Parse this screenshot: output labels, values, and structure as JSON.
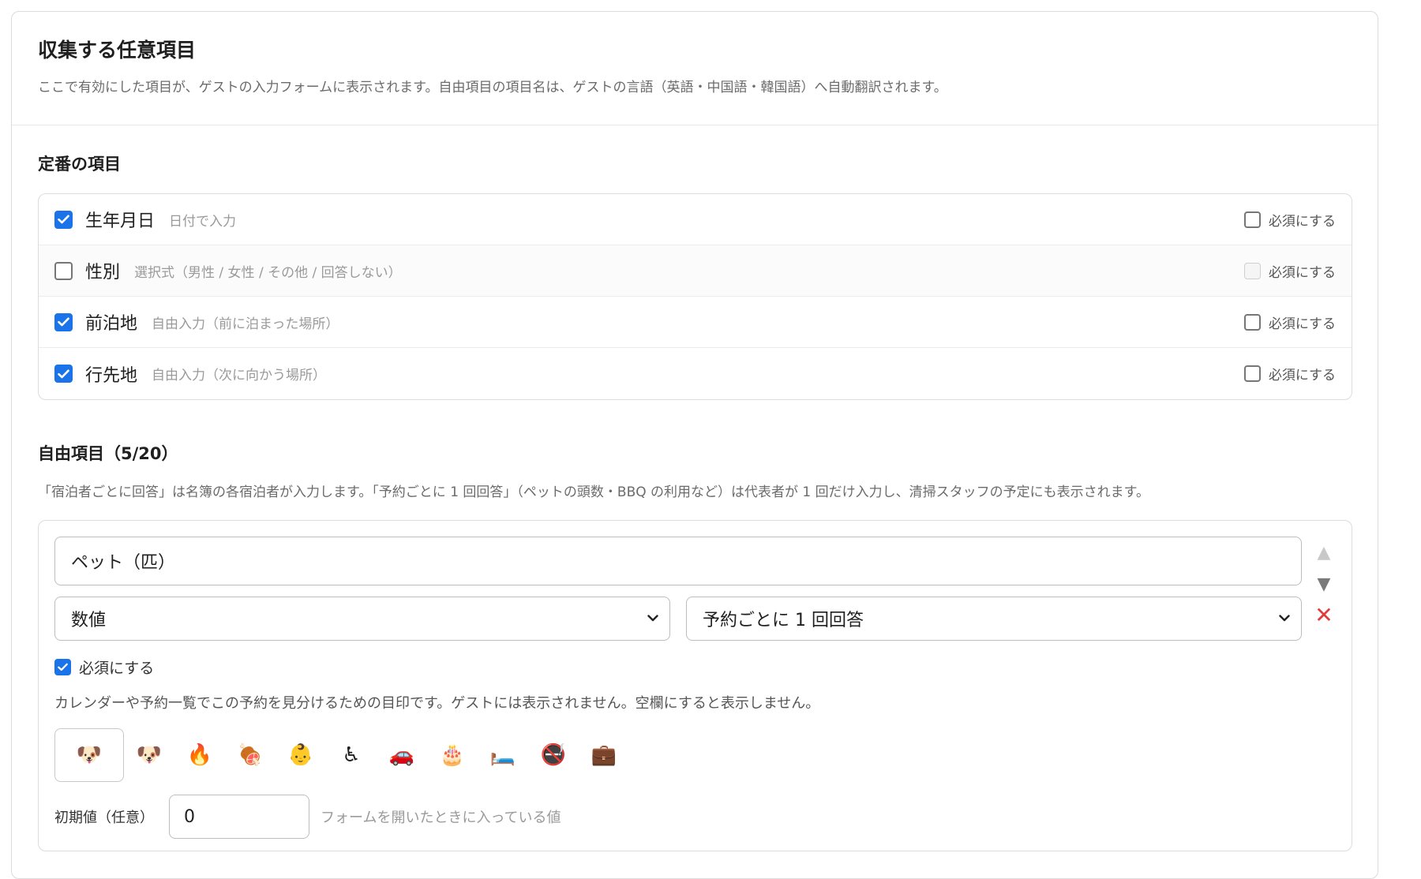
{
  "header": {
    "title": "収集する任意項目",
    "description": "ここで有効にした項目が、ゲストの入力フォームに表示されます。自由項目の項目名は、ゲストの言語（英語・中国語・韓国語）へ自動翻訳されます。"
  },
  "standard": {
    "title": "定番の項目",
    "required_label": "必須にする",
    "items": [
      {
        "label": "生年月日",
        "hint": "日付で入力",
        "enabled": true,
        "required": false,
        "required_disabled": false
      },
      {
        "label": "性別",
        "hint": "選択式（男性 / 女性 / その他 / 回答しない）",
        "enabled": false,
        "required": false,
        "required_disabled": true
      },
      {
        "label": "前泊地",
        "hint": "自由入力（前に泊まった場所）",
        "enabled": true,
        "required": false,
        "required_disabled": false
      },
      {
        "label": "行先地",
        "hint": "自由入力（次に向かう場所）",
        "enabled": true,
        "required": false,
        "required_disabled": false
      }
    ]
  },
  "free": {
    "title": "自由項目（5/20）",
    "description": "「宿泊者ごとに回答」は名簿の各宿泊者が入力します。「予約ごとに 1 回回答」（ペットの頭数・BBQ の利用など）は代表者が 1 回だけ入力し、清掃スタッフの予定にも表示されます。",
    "item": {
      "name": "ペット（匹）",
      "type": "数値",
      "scope": "予約ごとに 1 回回答",
      "required": true,
      "required_label": "必須にする",
      "marker_description": "カレンダーや予約一覧でこの予約を見分けるための目印です。ゲストには表示されません。空欄にすると表示しません。",
      "selected_emoji": "🐶",
      "emoji_options": [
        "🐶",
        "🔥",
        "🍖",
        "👶",
        "♿",
        "🚗",
        "🎂",
        "🛏️",
        "🚭",
        "💼"
      ],
      "default_label": "初期値（任意）",
      "default_value": "0",
      "default_hint": "フォームを開いたときに入っている値"
    }
  },
  "colors": {
    "accent": "#1a73e8",
    "danger": "#e23b3b"
  }
}
